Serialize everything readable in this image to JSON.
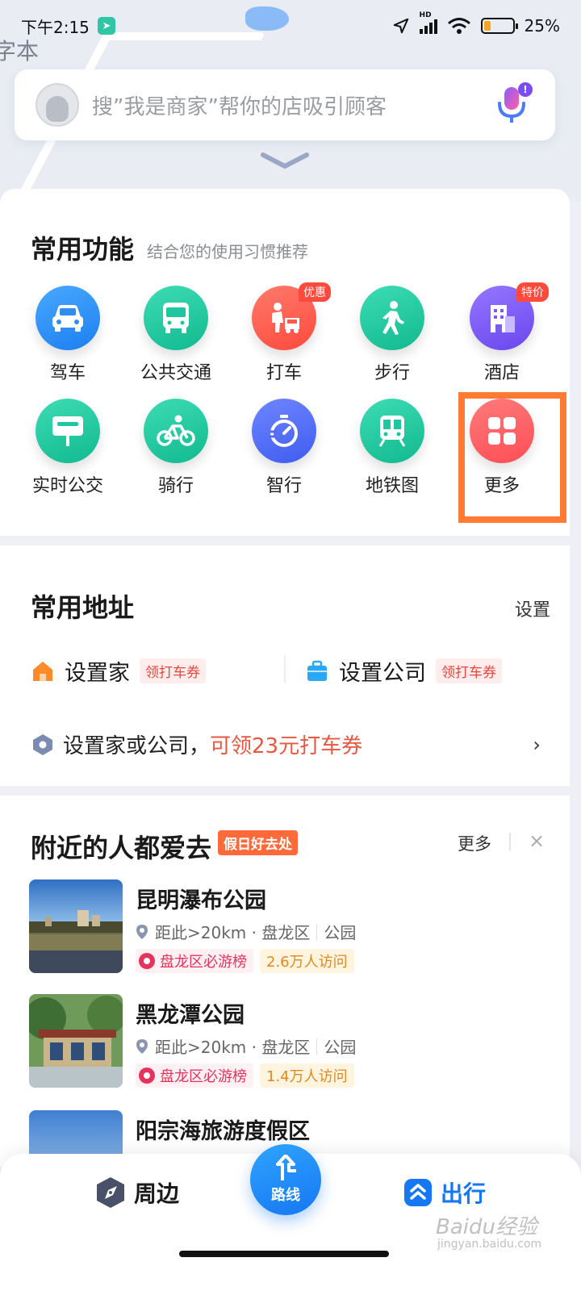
{
  "status_bar": {
    "time": "下午2:15",
    "network": "HD",
    "battery_percent": "25%",
    "battery_level": 0.25
  },
  "map": {
    "label": "字本"
  },
  "search": {
    "placeholder": "搜”我是商家”帮你的店吸引顾客",
    "mic_badge": "!"
  },
  "functions": {
    "title": "常用功能",
    "subtitle": "结合您的使用习惯推荐",
    "items": [
      {
        "label": "驾车",
        "icon": "car-icon",
        "color": "#2f8df5"
      },
      {
        "label": "公共交通",
        "icon": "bus-icon",
        "color": "#1fc7a0"
      },
      {
        "label": "打车",
        "icon": "taxi-icon",
        "color": "#ff5a4e",
        "badge": "优惠"
      },
      {
        "label": "步行",
        "icon": "walk-icon",
        "color": "#1fc7a0"
      },
      {
        "label": "酒店",
        "icon": "hotel-icon",
        "color": "#7a5cf5",
        "badge": "特价"
      },
      {
        "label": "实时公交",
        "icon": "bus-stop-icon",
        "color": "#1fc7a0"
      },
      {
        "label": "骑行",
        "icon": "bike-icon",
        "color": "#1fc7a0"
      },
      {
        "label": "智行",
        "icon": "smart-travel-icon",
        "color": "#4d6af5"
      },
      {
        "label": "地铁图",
        "icon": "metro-icon",
        "color": "#1fc7a0"
      },
      {
        "label": "更多",
        "icon": "grid-icon",
        "color": "#ff5a5a"
      }
    ]
  },
  "address": {
    "title": "常用地址",
    "setting": "设置",
    "home_label": "设置家",
    "home_coupon": "领打车券",
    "company_label": "设置公司",
    "company_coupon": "领打车券",
    "promo_prefix": "设置家或公司，",
    "promo_highlight": "可领23元打车券",
    "promo_chevron": "›"
  },
  "nearby": {
    "title": "附近的人都爱去",
    "tag": "假日好去处",
    "more": "更多",
    "close": "×",
    "places": [
      {
        "name": "昆明瀑布公园",
        "distance": "距此>20km · 盘龙区",
        "category": "公园",
        "rank": "盘龙区必游榜",
        "visits": "2.6万人访问"
      },
      {
        "name": "黑龙潭公园",
        "distance": "距此>20km · 盘龙区",
        "category": "公园",
        "rank": "盘龙区必游榜",
        "visits": "1.4万人访问"
      },
      {
        "name": "阳宗海旅游度假区"
      }
    ]
  },
  "bottom_nav": {
    "nearby": "周边",
    "route": "路线",
    "travel": "出行"
  },
  "watermark": {
    "brand": "Baidu经验",
    "url": "jingyan.baidu.com"
  }
}
